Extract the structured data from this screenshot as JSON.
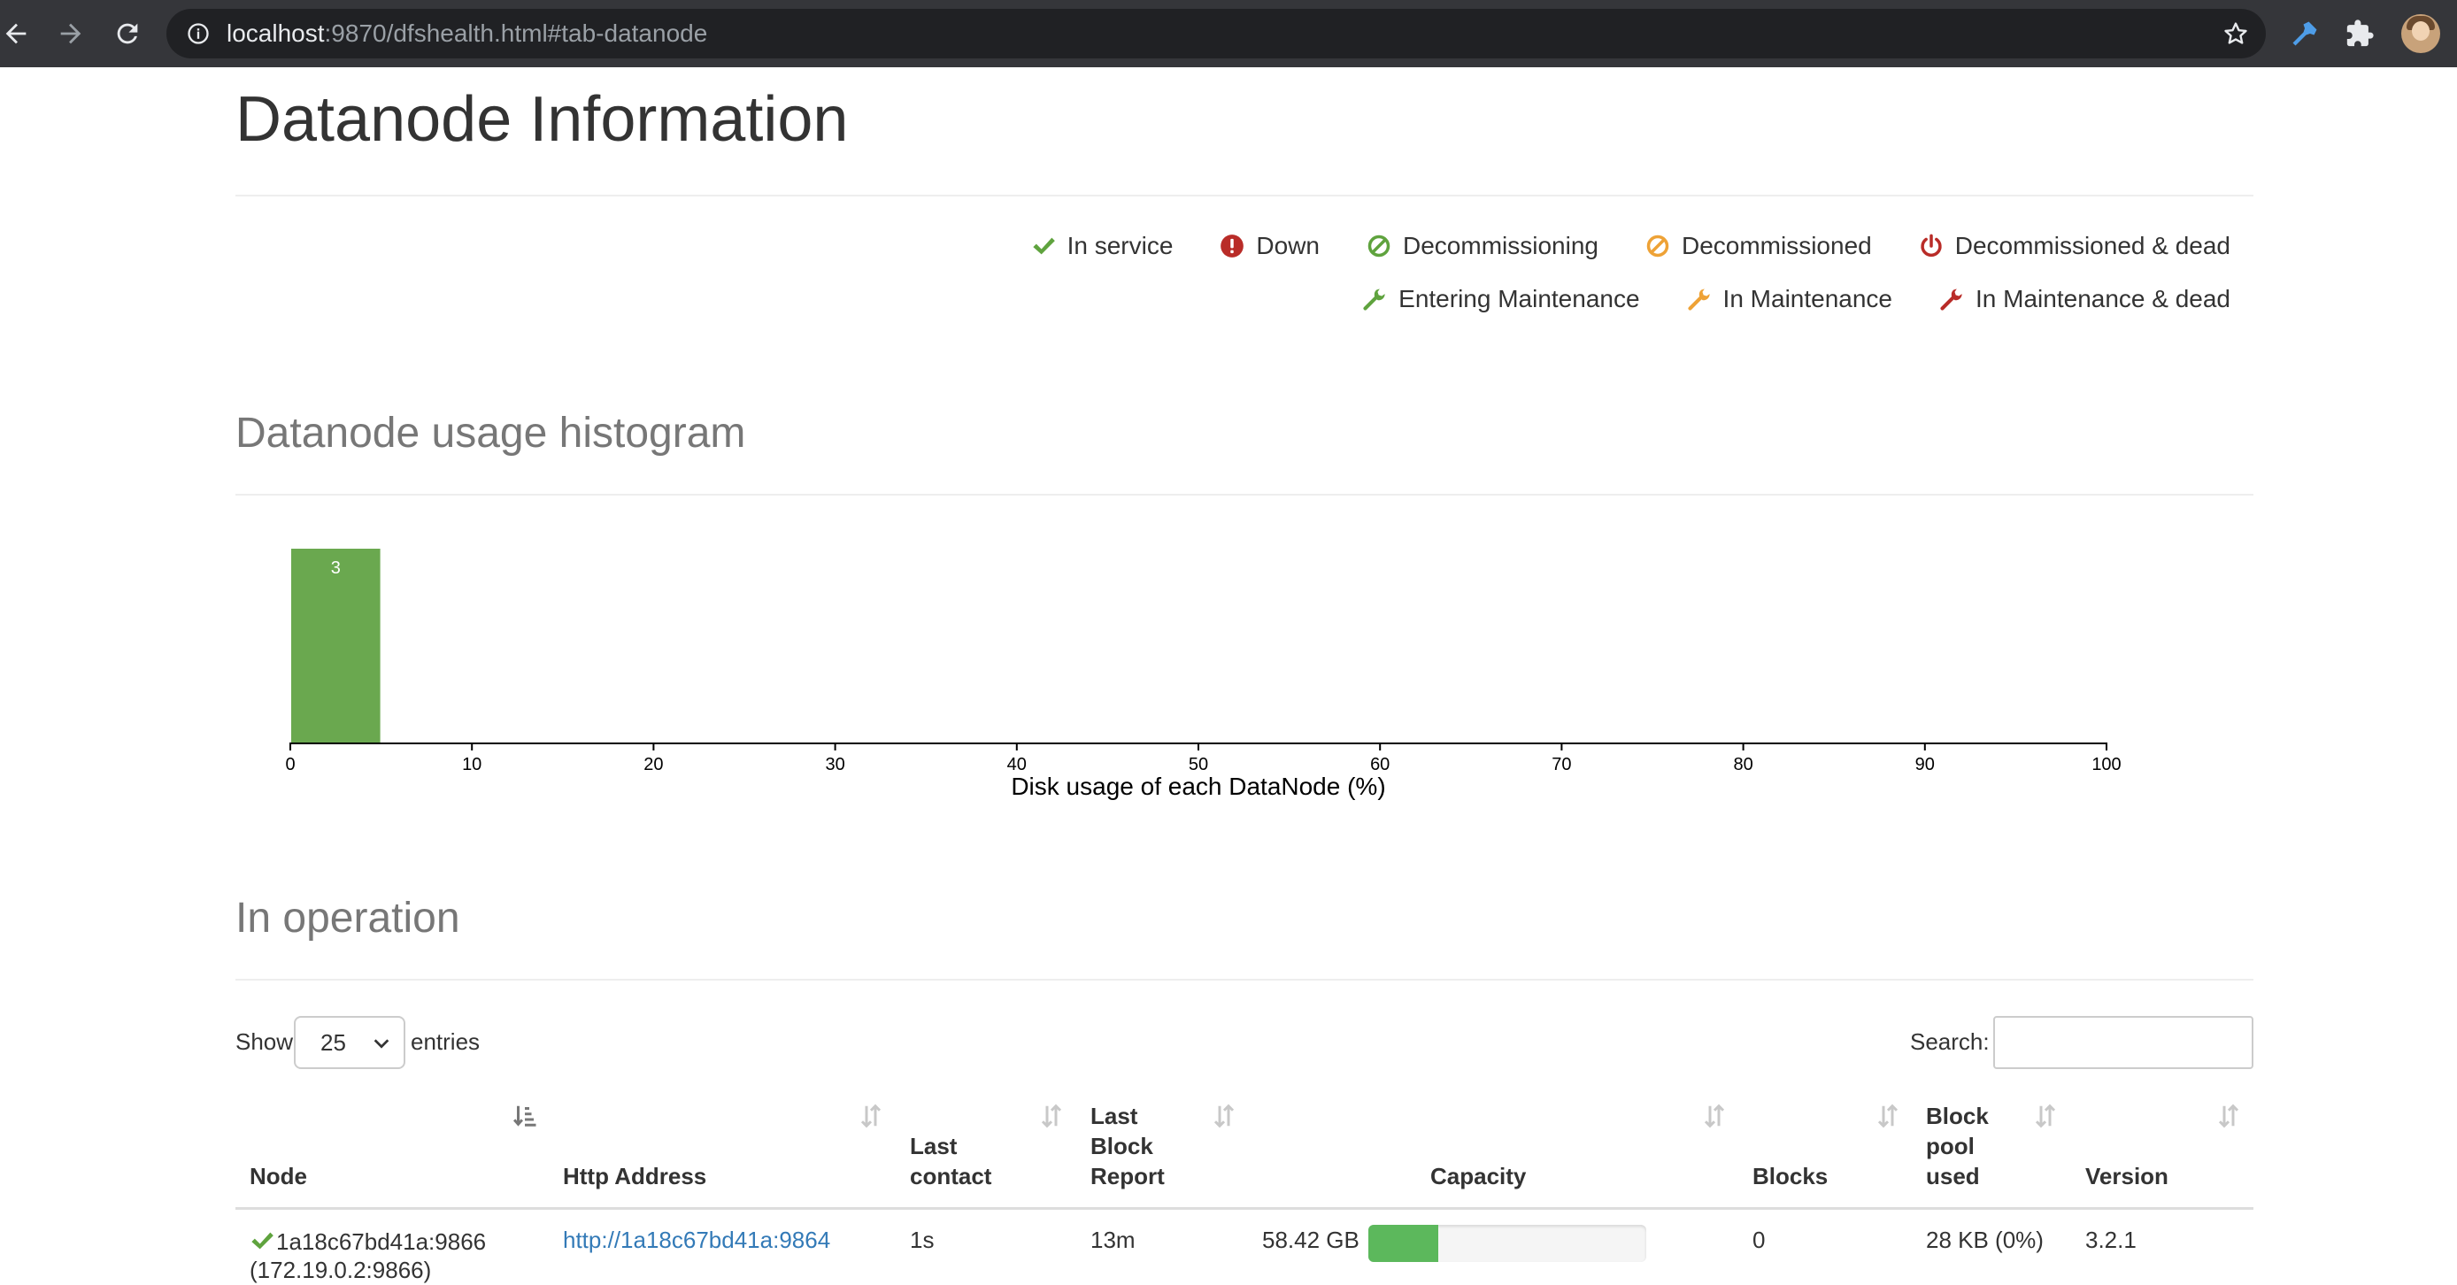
{
  "browser": {
    "url_host": "localhost",
    "url_rest": ":9870/dfshealth.html#tab-datanode"
  },
  "page": {
    "title": "Datanode Information"
  },
  "legend": {
    "row1": [
      {
        "label": "In service",
        "icon": "check-icon",
        "color": "#5fa33e"
      },
      {
        "label": "Down",
        "icon": "exclamation-circle-icon",
        "color": "#b92c28"
      },
      {
        "label": "Decommissioning",
        "icon": "ban-circle-icon",
        "color": "#5fa33e"
      },
      {
        "label": "Decommissioned",
        "icon": "ban-circle-icon",
        "color": "#eea236"
      },
      {
        "label": "Decommissioned & dead",
        "icon": "power-off-icon",
        "color": "#b92c28"
      }
    ],
    "row2": [
      {
        "label": "Entering Maintenance",
        "icon": "wrench-icon",
        "color": "#5fa33e"
      },
      {
        "label": "In Maintenance",
        "icon": "wrench-icon",
        "color": "#eea236"
      },
      {
        "label": "In Maintenance & dead",
        "icon": "wrench-icon",
        "color": "#b92c28"
      }
    ]
  },
  "histogram": {
    "title": "Datanode usage histogram"
  },
  "chart_data": {
    "type": "bar",
    "title": "",
    "xlabel": "Disk usage of each DataNode (%)",
    "ylabel": "",
    "xlim": [
      0,
      100
    ],
    "x_ticks": [
      0,
      10,
      20,
      30,
      40,
      50,
      60,
      70,
      80,
      90,
      100
    ],
    "bins": [
      {
        "x0": 0,
        "x1": 5,
        "count": 3
      }
    ],
    "bar_color": "#6aa84f",
    "grid": false
  },
  "operation": {
    "title": "In operation",
    "show_label": "Show",
    "entries_value": "25",
    "entries_label": "entries",
    "search_label": "Search:",
    "search_value": "",
    "headers": {
      "node": "Node",
      "http": "Http Address",
      "last_contact_1": "Last",
      "last_contact_2": "contact",
      "last_block_1": "Last",
      "last_block_2": "Block",
      "last_block_3": "Report",
      "capacity": "Capacity",
      "blocks": "Blocks",
      "pool_1": "Block",
      "pool_2": "pool",
      "pool_3": "used",
      "version": "Version"
    },
    "rows": [
      {
        "node": "1a18c67bd41a:9866",
        "node_ip": "(172.19.0.2:9866)",
        "http": "http://1a18c67bd41a:9864",
        "last_contact": "1s",
        "last_block_report": "13m",
        "capacity": "58.42 GB",
        "capacity_used_fraction": 0.25,
        "blocks": "0",
        "block_pool_used": "28 KB (0%)",
        "version": "3.2.1"
      }
    ]
  }
}
